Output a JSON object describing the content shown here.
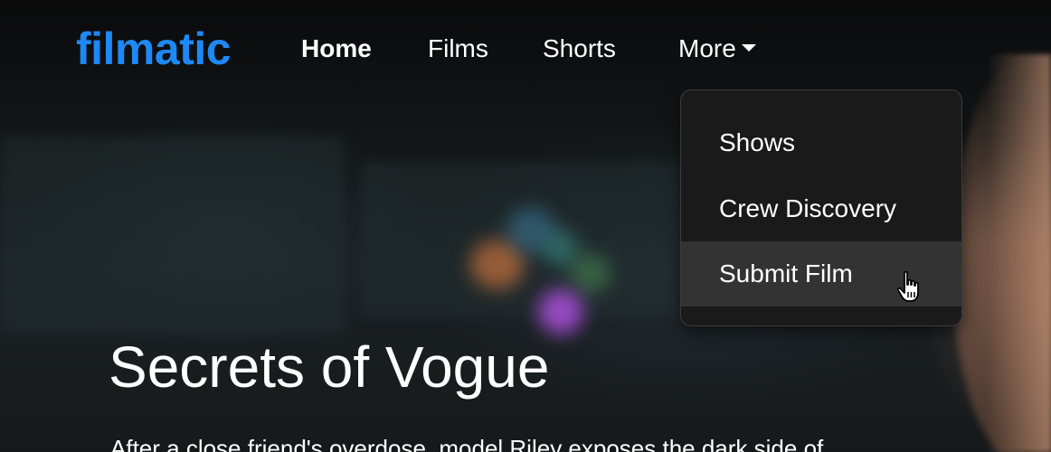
{
  "brand": {
    "name": "filmatic",
    "color": "#1e88f5"
  },
  "nav": {
    "items": [
      {
        "label": "Home",
        "active": true
      },
      {
        "label": "Films",
        "active": false
      },
      {
        "label": "Shorts",
        "active": false
      },
      {
        "label": "More",
        "active": false,
        "has_dropdown": true
      }
    ]
  },
  "dropdown": {
    "open": true,
    "items": [
      {
        "label": "Shows"
      },
      {
        "label": "Crew Discovery"
      },
      {
        "label": "Submit Film",
        "hovered": true
      }
    ]
  },
  "hero": {
    "title": "Secrets of Vogue",
    "description": "After a close friend's overdose, model Riley exposes the dark side of"
  },
  "icons": {
    "caret": "caret-down-icon",
    "cursor": "hand-pointer-icon"
  }
}
